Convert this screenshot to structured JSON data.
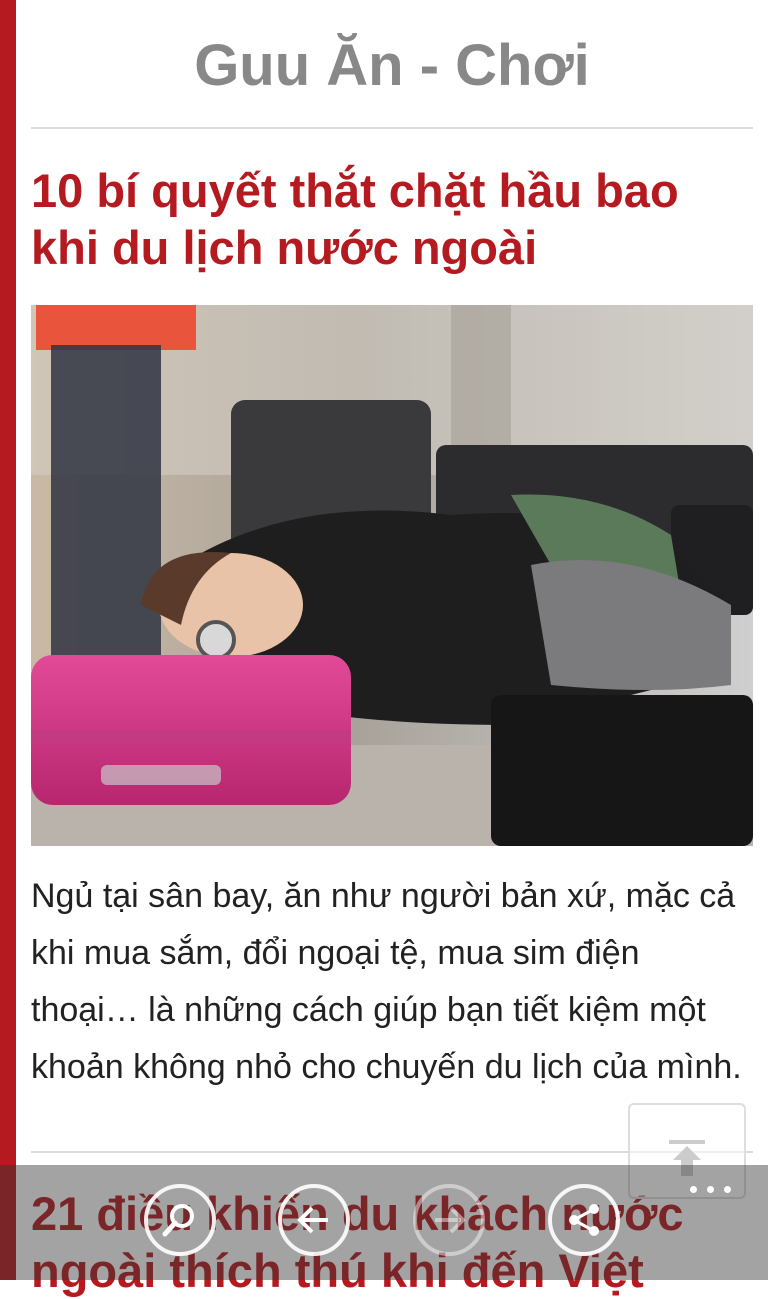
{
  "section": {
    "title": "Guu Ăn - Chơi"
  },
  "article": {
    "title": "10 bí quyết thắt chặt hầu bao khi du lịch nước ngoài",
    "summary": "Ngủ tại sân bay, ăn như người bản xứ, mặc cả khi mua sắm, đổi ngoại tệ, mua sim điện thoại… là những cách giúp bạn tiết kiệm một khoản không nhỏ cho chuyến du lịch của mình.",
    "image": "photo of a woman sleeping on luggage at an airport"
  },
  "next_article": {
    "title": "21 điều khiến du khách nước ngoài thích thú khi đến Việt"
  },
  "icons": {
    "scroll_top": "scroll-to-top-icon",
    "search": "search-icon",
    "back": "back-arrow-icon",
    "forward": "forward-arrow-icon",
    "share": "share-icon",
    "more": "more-dots-icon"
  },
  "colors": {
    "accent": "#b41a1f",
    "section_title": "#888888",
    "text": "#222222"
  }
}
